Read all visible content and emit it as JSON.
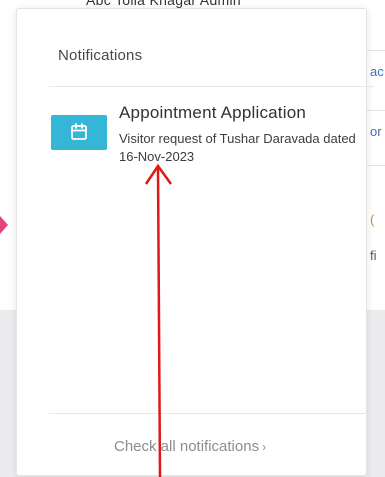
{
  "background": {
    "header_fragment": "Abc Tolla Khagar Admin",
    "right_fragments": [
      "ac",
      "or",
      "(",
      "fi"
    ]
  },
  "dropdown": {
    "title": "Notifications",
    "items": [
      {
        "icon": "calendar-icon",
        "title": "Appointment Application",
        "description": "Visitor request of Tushar Daravada dated 16-Nov-2023"
      }
    ],
    "footer_link": "Check all notifications",
    "footer_chevron": "›"
  },
  "colors": {
    "icon_bg": "#35b6d6",
    "annotation": "#e01818",
    "left_accent": "#e2457b",
    "right_link": "#3c6fb5"
  }
}
